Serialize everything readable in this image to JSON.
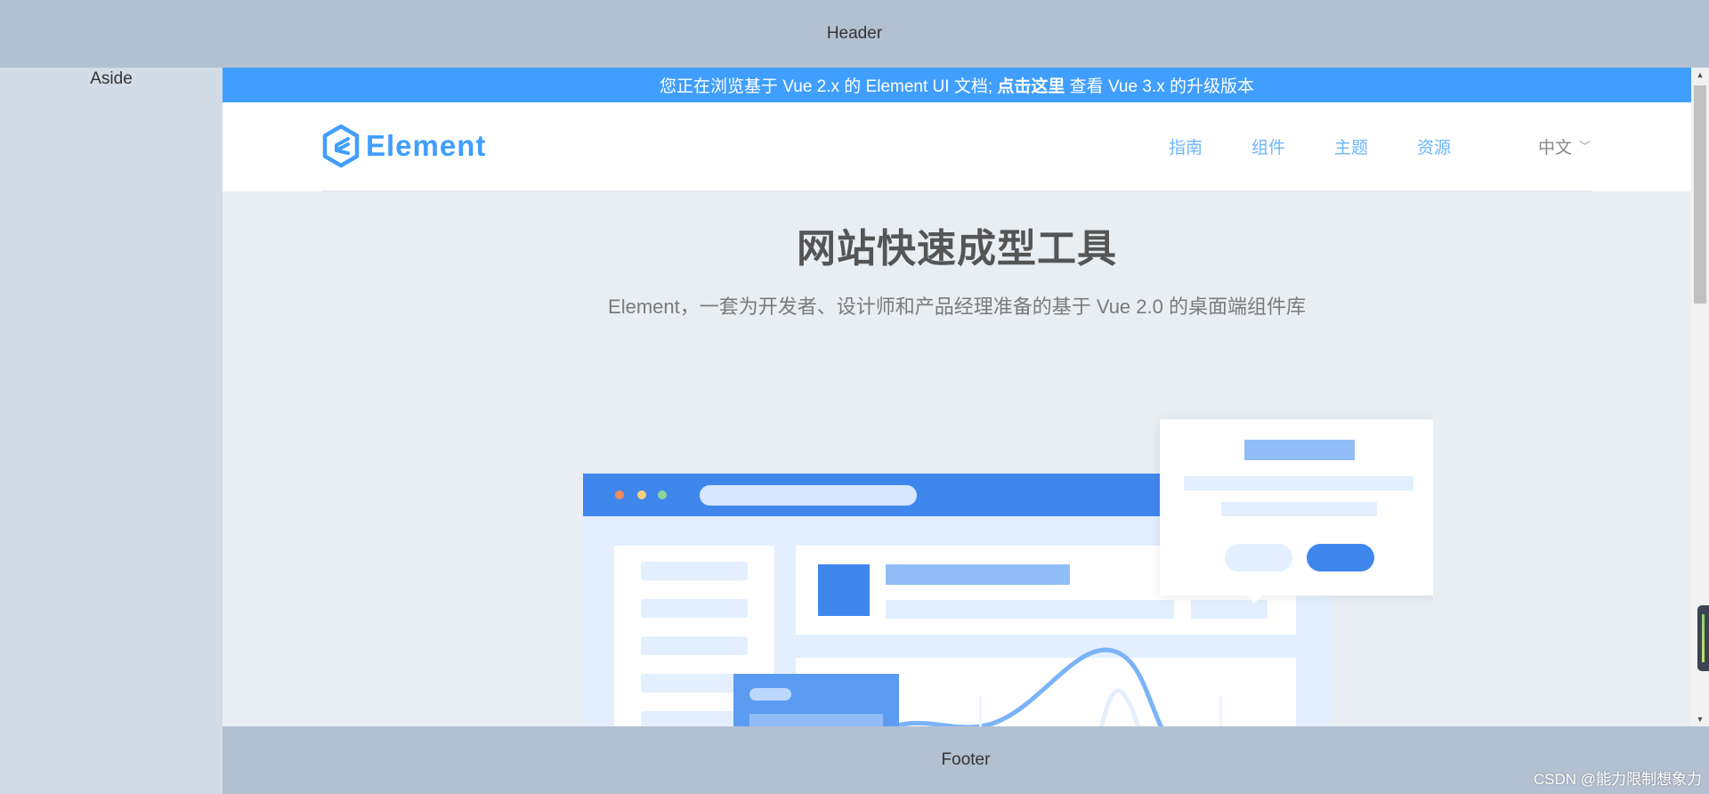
{
  "layout": {
    "header_label": "Header",
    "aside_label": "Aside",
    "footer_label": "Footer",
    "watermark": "CSDN @能力限制想象力"
  },
  "banner": {
    "text_before": "您正在浏览基于 Vue 2.x 的 Element UI 文档; ",
    "link_text": "点击这里",
    "text_after": " 查看 Vue 3.x 的升级版本",
    "color": "#409eff"
  },
  "nav": {
    "logo_text": "Element",
    "logo_icon": "element-hexagon-logo",
    "links": [
      {
        "label": "指南"
      },
      {
        "label": "组件"
      },
      {
        "label": "主题"
      },
      {
        "label": "资源"
      }
    ],
    "language": "中文",
    "language_icon": "chevron-down-icon",
    "accent": "#409eff"
  },
  "hero": {
    "title": "网站快速成型工具",
    "subtitle": "Element，一套为开发者、设计师和产品经理准备的基于 Vue 2.0 的桌面端组件库"
  },
  "colors": {
    "header_bg": "#b3c0d1",
    "aside_bg": "#d3dce6",
    "main_bg": "#e9eef3"
  }
}
